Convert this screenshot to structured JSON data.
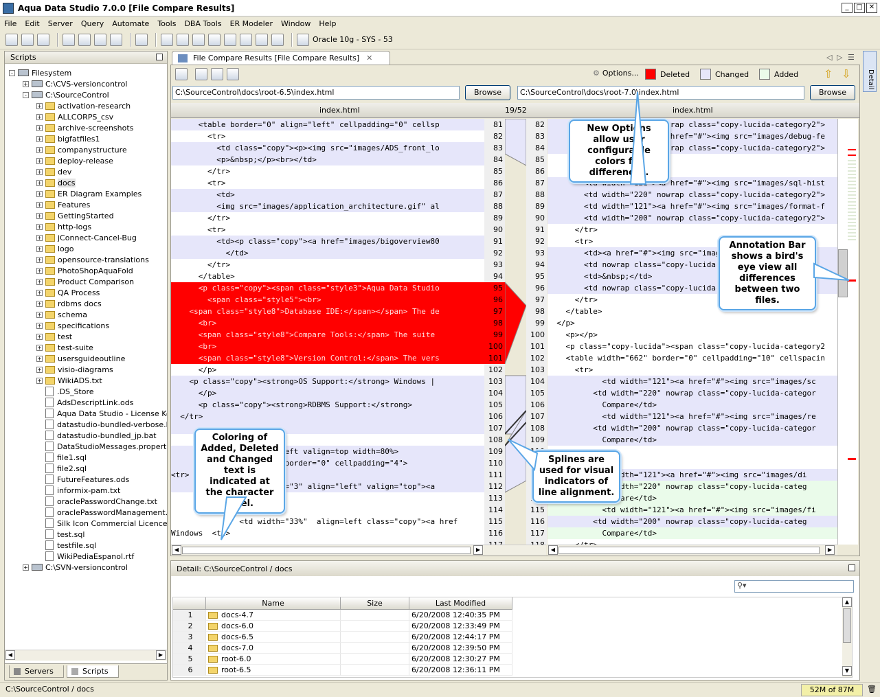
{
  "window": {
    "title": "Aqua Data Studio 7.0.0 [File Compare Results]"
  },
  "menu": [
    "File",
    "Edit",
    "Server",
    "Query",
    "Automate",
    "Tools",
    "DBA Tools",
    "ER Modeler",
    "Window",
    "Help"
  ],
  "toolbar": {
    "connection": "Oracle 10g - SYS - 53"
  },
  "scripts_panel": {
    "title": "Scripts",
    "tree": [
      {
        "label": "Filesystem",
        "level": 0,
        "kind": "root",
        "exp": "-"
      },
      {
        "label": "C:\\CVS-versioncontrol",
        "level": 1,
        "kind": "drive",
        "exp": "+"
      },
      {
        "label": "C:\\SourceControl",
        "level": 1,
        "kind": "drive",
        "exp": "-"
      },
      {
        "label": "activation-research",
        "level": 2,
        "kind": "folder",
        "exp": "+"
      },
      {
        "label": "ALLCORPS_csv",
        "level": 2,
        "kind": "folder",
        "exp": "+"
      },
      {
        "label": "archive-screenshots",
        "level": 2,
        "kind": "folder",
        "exp": "+"
      },
      {
        "label": "bigfatfiles1",
        "level": 2,
        "kind": "folder",
        "exp": "+"
      },
      {
        "label": "companystructure",
        "level": 2,
        "kind": "folder",
        "exp": "+"
      },
      {
        "label": "deploy-release",
        "level": 2,
        "kind": "folder",
        "exp": "+"
      },
      {
        "label": "dev",
        "level": 2,
        "kind": "folder",
        "exp": "+"
      },
      {
        "label": "docs",
        "level": 2,
        "kind": "folder",
        "exp": "+",
        "selected": true
      },
      {
        "label": "ER Diagram Examples",
        "level": 2,
        "kind": "folder",
        "exp": "+"
      },
      {
        "label": "Features",
        "level": 2,
        "kind": "folder",
        "exp": "+"
      },
      {
        "label": "GettingStarted",
        "level": 2,
        "kind": "folder",
        "exp": "+"
      },
      {
        "label": "http-logs",
        "level": 2,
        "kind": "folder",
        "exp": "+"
      },
      {
        "label": "jConnect-Cancel-Bug",
        "level": 2,
        "kind": "folder",
        "exp": "+"
      },
      {
        "label": "logo",
        "level": 2,
        "kind": "folder",
        "exp": "+"
      },
      {
        "label": "opensource-translations",
        "level": 2,
        "kind": "folder",
        "exp": "+"
      },
      {
        "label": "PhotoShopAquaFold",
        "level": 2,
        "kind": "folder",
        "exp": "+"
      },
      {
        "label": "Product Comparison",
        "level": 2,
        "kind": "folder",
        "exp": "+"
      },
      {
        "label": "QA Process",
        "level": 2,
        "kind": "folder",
        "exp": "+"
      },
      {
        "label": "rdbms docs",
        "level": 2,
        "kind": "folder",
        "exp": "+"
      },
      {
        "label": "schema",
        "level": 2,
        "kind": "folder",
        "exp": "+"
      },
      {
        "label": "specifications",
        "level": 2,
        "kind": "folder",
        "exp": "+"
      },
      {
        "label": "test",
        "level": 2,
        "kind": "folder",
        "exp": "+"
      },
      {
        "label": "test-suite",
        "level": 2,
        "kind": "folder",
        "exp": "+"
      },
      {
        "label": "usersguideoutline",
        "level": 2,
        "kind": "folder",
        "exp": "+"
      },
      {
        "label": "visio-diagrams",
        "level": 2,
        "kind": "folder",
        "exp": "+"
      },
      {
        "label": "WikiADS.txt",
        "level": 2,
        "kind": "folder",
        "exp": "+"
      },
      {
        "label": ".DS_Store",
        "level": 2,
        "kind": "file",
        "exp": ""
      },
      {
        "label": "AdsDescriptLink.ods",
        "level": 2,
        "kind": "file",
        "exp": ""
      },
      {
        "label": "Aqua Data Studio - License Key",
        "level": 2,
        "kind": "file",
        "exp": ""
      },
      {
        "label": "datastudio-bundled-verbose.ba",
        "level": 2,
        "kind": "file",
        "exp": ""
      },
      {
        "label": "datastudio-bundled_jp.bat",
        "level": 2,
        "kind": "file",
        "exp": ""
      },
      {
        "label": "DataStudioMessages.properties",
        "level": 2,
        "kind": "file",
        "exp": ""
      },
      {
        "label": "file1.sql",
        "level": 2,
        "kind": "file",
        "exp": ""
      },
      {
        "label": "file2.sql",
        "level": 2,
        "kind": "file",
        "exp": ""
      },
      {
        "label": "FutureFeatures.ods",
        "level": 2,
        "kind": "file",
        "exp": ""
      },
      {
        "label": "informix-pam.txt",
        "level": 2,
        "kind": "file",
        "exp": ""
      },
      {
        "label": "oraclePasswordChange.txt",
        "level": 2,
        "kind": "file",
        "exp": ""
      },
      {
        "label": "oraclePasswordManagement.ja",
        "level": 2,
        "kind": "file",
        "exp": ""
      },
      {
        "label": "Silk Icon Commercial Licence.txt",
        "level": 2,
        "kind": "file",
        "exp": ""
      },
      {
        "label": "test.sql",
        "level": 2,
        "kind": "file",
        "exp": ""
      },
      {
        "label": "testfile.sql",
        "level": 2,
        "kind": "file",
        "exp": ""
      },
      {
        "label": "WikiPediaEspanol.rtf",
        "level": 2,
        "kind": "file",
        "exp": ""
      },
      {
        "label": "C:\\SVN-versioncontrol",
        "level": 1,
        "kind": "drive",
        "exp": "+"
      }
    ],
    "tabs": [
      "Servers",
      "Scripts"
    ]
  },
  "editor": {
    "tab_title": "File Compare Results [File Compare Results]",
    "options_label": "Options...",
    "legend": [
      {
        "label": "Deleted",
        "color": "#ff0000"
      },
      {
        "label": "Changed",
        "color": "#e6e6fa"
      },
      {
        "label": "Added",
        "color": "#eafbea"
      }
    ],
    "left_path": "C:\\SourceControl\\docs\\root-6.5\\index.html",
    "right_path": "C:\\SourceControl\\docs\\root-7.0\\index.html",
    "browse_label": "Browse",
    "left_header": "index.html",
    "right_header": "index.html",
    "diff_position": "19/52",
    "left_lines": [
      {
        "n": "81",
        "t": "      <table border=\"0\" align=\"left\" cellpadding=\"0\" cellsp",
        "c": "changed"
      },
      {
        "n": "82",
        "t": "        <tr>",
        "c": "white"
      },
      {
        "n": "83",
        "t": "          <td class=\"copy\"><p><img src=\"images/ADS_front_lo",
        "c": "changed"
      },
      {
        "n": "84",
        "t": "          <p>&nbsp;</p><br></td>",
        "c": "changed"
      },
      {
        "n": "85",
        "t": "        </tr>",
        "c": "white"
      },
      {
        "n": "86",
        "t": "        <tr>",
        "c": "white"
      },
      {
        "n": "87",
        "t": "          <td>",
        "c": "changed"
      },
      {
        "n": "88",
        "t": "          <img src=\"images/application_architecture.gif\" al",
        "c": "changed"
      },
      {
        "n": "89",
        "t": "        </tr>",
        "c": "white"
      },
      {
        "n": "90",
        "t": "        <tr>",
        "c": "white"
      },
      {
        "n": "91",
        "t": "          <td><p class=\"copy\"><a href=\"images/bigoverview80",
        "c": "changed"
      },
      {
        "n": "92",
        "t": "            </td>",
        "c": "changed"
      },
      {
        "n": "93",
        "t": "        </tr>",
        "c": "white"
      },
      {
        "n": "94",
        "t": "      </table>",
        "c": "white"
      },
      {
        "n": "95",
        "t": "      <p class=\"copy\"><span class=\"style3\">Aqua Data Studio",
        "c": "deleted"
      },
      {
        "n": "96",
        "t": "        <span class=\"style5\"><br>",
        "c": "deleted"
      },
      {
        "n": "97",
        "t": "    <span class=\"style8\">Database IDE:</span></span> The de",
        "c": "deleted"
      },
      {
        "n": "98",
        "t": "      <br>",
        "c": "deleted"
      },
      {
        "n": "99",
        "t": "      <span class=\"style8\">Compare Tools:</span> The suite",
        "c": "deleted"
      },
      {
        "n": "100",
        "t": "      <br>",
        "c": "deleted"
      },
      {
        "n": "101",
        "t": "      <span class=\"style8\">Version Control:</span> The vers",
        "c": "deleted"
      },
      {
        "n": "102",
        "t": "      </p>",
        "c": "white"
      },
      {
        "n": "103",
        "t": "    <p class=\"copy\"><strong>OS Support:</strong> Windows |",
        "c": "changed"
      },
      {
        "n": "104",
        "t": "      </p>",
        "c": "changed"
      },
      {
        "n": "105",
        "t": "      <p class=\"copy\"><strong>RDBMS Support:</strong>",
        "c": "changed"
      },
      {
        "n": "106",
        "t": "  </tr>",
        "c": "changed"
      },
      {
        "n": "107",
        "t": "",
        "c": "changed"
      },
      {
        "n": "108",
        "t": "",
        "c": "white"
      },
      {
        "n": "109",
        "t": "                  align=left valign=top width=80%>",
        "c": "changed"
      },
      {
        "n": "110",
        "t": "                  \"100%\" border=\"0\" cellpadding=\"4\">",
        "c": "changed"
      },
      {
        "n": "111",
        "t": "<tr>",
        "c": "changed"
      },
      {
        "n": "112",
        "t": "                  colspan=\"3\" align=\"left\" valign=\"top\"><a",
        "c": "changed"
      },
      {
        "n": "113",
        "t": "",
        "c": "white"
      },
      {
        "n": "114",
        "t": "        <tr>",
        "c": "white"
      },
      {
        "n": "115",
        "t": "               <td width=\"33%\"  align=left class=\"copy\"><a href",
        "c": "white"
      },
      {
        "n": "116",
        "t": "Windows  <td>",
        "c": "white"
      },
      {
        "n": "117",
        "t": "",
        "c": "white"
      }
    ],
    "right_lines": [
      {
        "n": "82",
        "t": "        <td width=\"200\" nowrap class=\"copy-lucida-category2\">",
        "c": "changed"
      },
      {
        "n": "83",
        "t": "        <td width=\"121\"><a href=\"#\"><img src=\"images/debug-fe",
        "c": "changed"
      },
      {
        "n": "84",
        "t": "        <td width=\"200\" nowrap class=\"copy-lucida-category2\">",
        "c": "changed"
      },
      {
        "n": "85",
        "t": "      </tr>",
        "c": "white"
      },
      {
        "n": "86",
        "t": "      <tr>",
        "c": "white"
      },
      {
        "n": "87",
        "t": "        <td width=\"121\"><a href=\"#\"><img src=\"images/sql-hist",
        "c": "changed"
      },
      {
        "n": "88",
        "t": "        <td width=\"220\" nowrap class=\"copy-lucida-category2\">",
        "c": "changed"
      },
      {
        "n": "89",
        "t": "        <td width=\"121\"><a href=\"#\"><img src=\"images/format-f",
        "c": "changed"
      },
      {
        "n": "90",
        "t": "        <td width=\"200\" nowrap class=\"copy-lucida-category2\">",
        "c": "changed"
      },
      {
        "n": "91",
        "t": "      </tr>",
        "c": "white"
      },
      {
        "n": "92",
        "t": "      <tr>",
        "c": "white"
      },
      {
        "n": "93",
        "t": "        <td><a href=\"#\"><img src=\"images/sql-",
        "c": "changed"
      },
      {
        "n": "94",
        "t": "        <td nowrap class=\"copy-lucida-",
        "c": "changed"
      },
      {
        "n": "95",
        "t": "        <td>&nbsp;</td>",
        "c": "changed"
      },
      {
        "n": "96",
        "t": "        <td nowrap class=\"copy-lucida-",
        "c": "changed"
      },
      {
        "n": "97",
        "t": "      </tr>",
        "c": "white"
      },
      {
        "n": "98",
        "t": "    </table>",
        "c": "white"
      },
      {
        "n": "99",
        "t": "  </p>",
        "c": "white"
      },
      {
        "n": "100",
        "t": "    <p></p>",
        "c": "white"
      },
      {
        "n": "101",
        "t": "    <p class=\"copy-lucida\"><span class=\"copy-lucida-category2",
        "c": "white"
      },
      {
        "n": "102",
        "t": "    <table width=\"662\" border=\"0\" cellpadding=\"10\" cellspacin",
        "c": "white"
      },
      {
        "n": "103",
        "t": "      <tr>",
        "c": "white"
      },
      {
        "n": "104",
        "t": "            <td width=\"121\"><a href=\"#\"><img src=\"images/sc",
        "c": "changed"
      },
      {
        "n": "105",
        "t": "          <td width=\"220\" nowrap class=\"copy-lucida-categor",
        "c": "changed"
      },
      {
        "n": "106",
        "t": "            Compare</td>",
        "c": "changed"
      },
      {
        "n": "107",
        "t": "            <td width=\"121\"><a href=\"#\"><img src=\"images/re",
        "c": "changed"
      },
      {
        "n": "108",
        "t": "          <td width=\"200\" nowrap class=\"copy-lucida-categor",
        "c": "changed"
      },
      {
        "n": "109",
        "t": "            Compare</td>",
        "c": "changed"
      },
      {
        "n": "110",
        "t": "",
        "c": "white"
      },
      {
        "n": "111",
        "t": "",
        "c": "white"
      },
      {
        "n": "112",
        "t": "          <td width=\"121\"><a href=\"#\"><img src=\"images/di",
        "c": "changed"
      },
      {
        "n": "113",
        "t": "          <td width=\"220\" nowrap class=\"copy-lucida-categ",
        "c": "added"
      },
      {
        "n": "114",
        "t": "            Compare</td>",
        "c": "added"
      },
      {
        "n": "115",
        "t": "            <td width=\"121\"><a href=\"#\"><img src=\"images/fi",
        "c": "added"
      },
      {
        "n": "116",
        "t": "          <td width=\"200\" nowrap class=\"copy-lucida-categ",
        "c": "changed"
      },
      {
        "n": "117",
        "t": "            Compare</td>",
        "c": "added"
      },
      {
        "n": "118",
        "t": "      </tr>",
        "c": "white"
      }
    ]
  },
  "callouts": {
    "options": "New Options allow user configurable colors for differences.",
    "annotation": "Annotation Bar shows a bird's eye view all differences between two files.",
    "coloring": "Coloring of Added, Deleted and Changed text is indicated at the character level.",
    "splines": "Splines are used for visual indicators of line alignment."
  },
  "detail": {
    "title": "Detail: C:\\SourceControl / docs",
    "columns": [
      "Name",
      "Size",
      "Last Modified"
    ],
    "rows": [
      {
        "num": "1",
        "name": "docs-4.7",
        "size": "",
        "modified": "6/20/2008 12:40:35 PM"
      },
      {
        "num": "2",
        "name": "docs-6.0",
        "size": "",
        "modified": "6/20/2008 12:33:49 PM"
      },
      {
        "num": "3",
        "name": "docs-6.5",
        "size": "",
        "modified": "6/20/2008 12:44:17 PM"
      },
      {
        "num": "4",
        "name": "docs-7.0",
        "size": "",
        "modified": "6/20/2008 12:39:50 PM"
      },
      {
        "num": "5",
        "name": "root-6.0",
        "size": "",
        "modified": "6/20/2008 12:30:27 PM"
      },
      {
        "num": "6",
        "name": "root-6.5",
        "size": "",
        "modified": "6/20/2008 12:36:11 PM"
      }
    ]
  },
  "side_strip": {
    "label": "Detail"
  },
  "status": {
    "path": "C:\\SourceControl / docs",
    "memory": "52M of 87M"
  },
  "colors": {
    "deleted": "#ff0000",
    "changed": "#e6e6fa",
    "added": "#eafbea",
    "callout_border": "#5aa6e6"
  }
}
